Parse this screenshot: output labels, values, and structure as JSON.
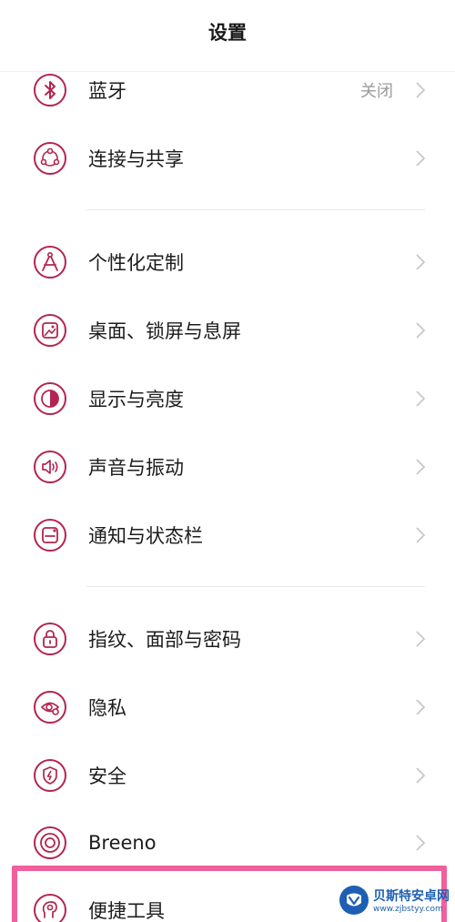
{
  "header": {
    "title": "设置"
  },
  "colors": {
    "accent": "#b3254f",
    "highlight": "#f0609c",
    "chevron": "#c8c8c8"
  },
  "settings": {
    "items": [
      {
        "label": "蓝牙",
        "value": "关闭",
        "icon": "bluetooth-icon"
      },
      {
        "label": "连接与共享",
        "icon": "share-icon"
      },
      {
        "label": "个性化定制",
        "icon": "personalization-icon"
      },
      {
        "label": "桌面、锁屏与息屏",
        "icon": "wallpaper-icon"
      },
      {
        "label": "显示与亮度",
        "icon": "brightness-icon"
      },
      {
        "label": "声音与振动",
        "icon": "speaker-icon"
      },
      {
        "label": "通知与状态栏",
        "icon": "notification-icon"
      },
      {
        "label": "指纹、面部与密码",
        "icon": "lock-icon"
      },
      {
        "label": "隐私",
        "icon": "privacy-eye-icon"
      },
      {
        "label": "安全",
        "icon": "security-bolt-icon"
      },
      {
        "label": "Breeno",
        "icon": "breeno-icon"
      },
      {
        "label": "便捷工具",
        "icon": "convenience-tools-icon"
      }
    ]
  },
  "watermark": {
    "title": "贝斯特安卓网",
    "url": "www.zjbstyy.com"
  }
}
